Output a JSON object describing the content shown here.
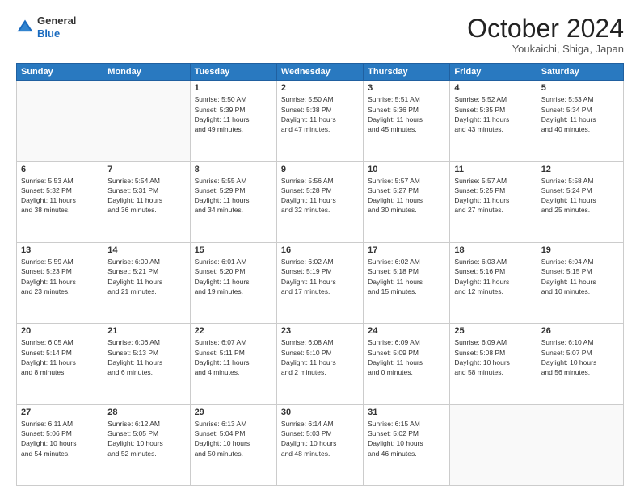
{
  "header": {
    "logo": {
      "line1": "General",
      "line2": "Blue"
    },
    "title": "October 2024",
    "location": "Youkaichi, Shiga, Japan"
  },
  "weekdays": [
    "Sunday",
    "Monday",
    "Tuesday",
    "Wednesday",
    "Thursday",
    "Friday",
    "Saturday"
  ],
  "weeks": [
    [
      {
        "day": "",
        "info": ""
      },
      {
        "day": "",
        "info": ""
      },
      {
        "day": "1",
        "info": "Sunrise: 5:50 AM\nSunset: 5:39 PM\nDaylight: 11 hours\nand 49 minutes."
      },
      {
        "day": "2",
        "info": "Sunrise: 5:50 AM\nSunset: 5:38 PM\nDaylight: 11 hours\nand 47 minutes."
      },
      {
        "day": "3",
        "info": "Sunrise: 5:51 AM\nSunset: 5:36 PM\nDaylight: 11 hours\nand 45 minutes."
      },
      {
        "day": "4",
        "info": "Sunrise: 5:52 AM\nSunset: 5:35 PM\nDaylight: 11 hours\nand 43 minutes."
      },
      {
        "day": "5",
        "info": "Sunrise: 5:53 AM\nSunset: 5:34 PM\nDaylight: 11 hours\nand 40 minutes."
      }
    ],
    [
      {
        "day": "6",
        "info": "Sunrise: 5:53 AM\nSunset: 5:32 PM\nDaylight: 11 hours\nand 38 minutes."
      },
      {
        "day": "7",
        "info": "Sunrise: 5:54 AM\nSunset: 5:31 PM\nDaylight: 11 hours\nand 36 minutes."
      },
      {
        "day": "8",
        "info": "Sunrise: 5:55 AM\nSunset: 5:29 PM\nDaylight: 11 hours\nand 34 minutes."
      },
      {
        "day": "9",
        "info": "Sunrise: 5:56 AM\nSunset: 5:28 PM\nDaylight: 11 hours\nand 32 minutes."
      },
      {
        "day": "10",
        "info": "Sunrise: 5:57 AM\nSunset: 5:27 PM\nDaylight: 11 hours\nand 30 minutes."
      },
      {
        "day": "11",
        "info": "Sunrise: 5:57 AM\nSunset: 5:25 PM\nDaylight: 11 hours\nand 27 minutes."
      },
      {
        "day": "12",
        "info": "Sunrise: 5:58 AM\nSunset: 5:24 PM\nDaylight: 11 hours\nand 25 minutes."
      }
    ],
    [
      {
        "day": "13",
        "info": "Sunrise: 5:59 AM\nSunset: 5:23 PM\nDaylight: 11 hours\nand 23 minutes."
      },
      {
        "day": "14",
        "info": "Sunrise: 6:00 AM\nSunset: 5:21 PM\nDaylight: 11 hours\nand 21 minutes."
      },
      {
        "day": "15",
        "info": "Sunrise: 6:01 AM\nSunset: 5:20 PM\nDaylight: 11 hours\nand 19 minutes."
      },
      {
        "day": "16",
        "info": "Sunrise: 6:02 AM\nSunset: 5:19 PM\nDaylight: 11 hours\nand 17 minutes."
      },
      {
        "day": "17",
        "info": "Sunrise: 6:02 AM\nSunset: 5:18 PM\nDaylight: 11 hours\nand 15 minutes."
      },
      {
        "day": "18",
        "info": "Sunrise: 6:03 AM\nSunset: 5:16 PM\nDaylight: 11 hours\nand 12 minutes."
      },
      {
        "day": "19",
        "info": "Sunrise: 6:04 AM\nSunset: 5:15 PM\nDaylight: 11 hours\nand 10 minutes."
      }
    ],
    [
      {
        "day": "20",
        "info": "Sunrise: 6:05 AM\nSunset: 5:14 PM\nDaylight: 11 hours\nand 8 minutes."
      },
      {
        "day": "21",
        "info": "Sunrise: 6:06 AM\nSunset: 5:13 PM\nDaylight: 11 hours\nand 6 minutes."
      },
      {
        "day": "22",
        "info": "Sunrise: 6:07 AM\nSunset: 5:11 PM\nDaylight: 11 hours\nand 4 minutes."
      },
      {
        "day": "23",
        "info": "Sunrise: 6:08 AM\nSunset: 5:10 PM\nDaylight: 11 hours\nand 2 minutes."
      },
      {
        "day": "24",
        "info": "Sunrise: 6:09 AM\nSunset: 5:09 PM\nDaylight: 11 hours\nand 0 minutes."
      },
      {
        "day": "25",
        "info": "Sunrise: 6:09 AM\nSunset: 5:08 PM\nDaylight: 10 hours\nand 58 minutes."
      },
      {
        "day": "26",
        "info": "Sunrise: 6:10 AM\nSunset: 5:07 PM\nDaylight: 10 hours\nand 56 minutes."
      }
    ],
    [
      {
        "day": "27",
        "info": "Sunrise: 6:11 AM\nSunset: 5:06 PM\nDaylight: 10 hours\nand 54 minutes."
      },
      {
        "day": "28",
        "info": "Sunrise: 6:12 AM\nSunset: 5:05 PM\nDaylight: 10 hours\nand 52 minutes."
      },
      {
        "day": "29",
        "info": "Sunrise: 6:13 AM\nSunset: 5:04 PM\nDaylight: 10 hours\nand 50 minutes."
      },
      {
        "day": "30",
        "info": "Sunrise: 6:14 AM\nSunset: 5:03 PM\nDaylight: 10 hours\nand 48 minutes."
      },
      {
        "day": "31",
        "info": "Sunrise: 6:15 AM\nSunset: 5:02 PM\nDaylight: 10 hours\nand 46 minutes."
      },
      {
        "day": "",
        "info": ""
      },
      {
        "day": "",
        "info": ""
      }
    ]
  ]
}
